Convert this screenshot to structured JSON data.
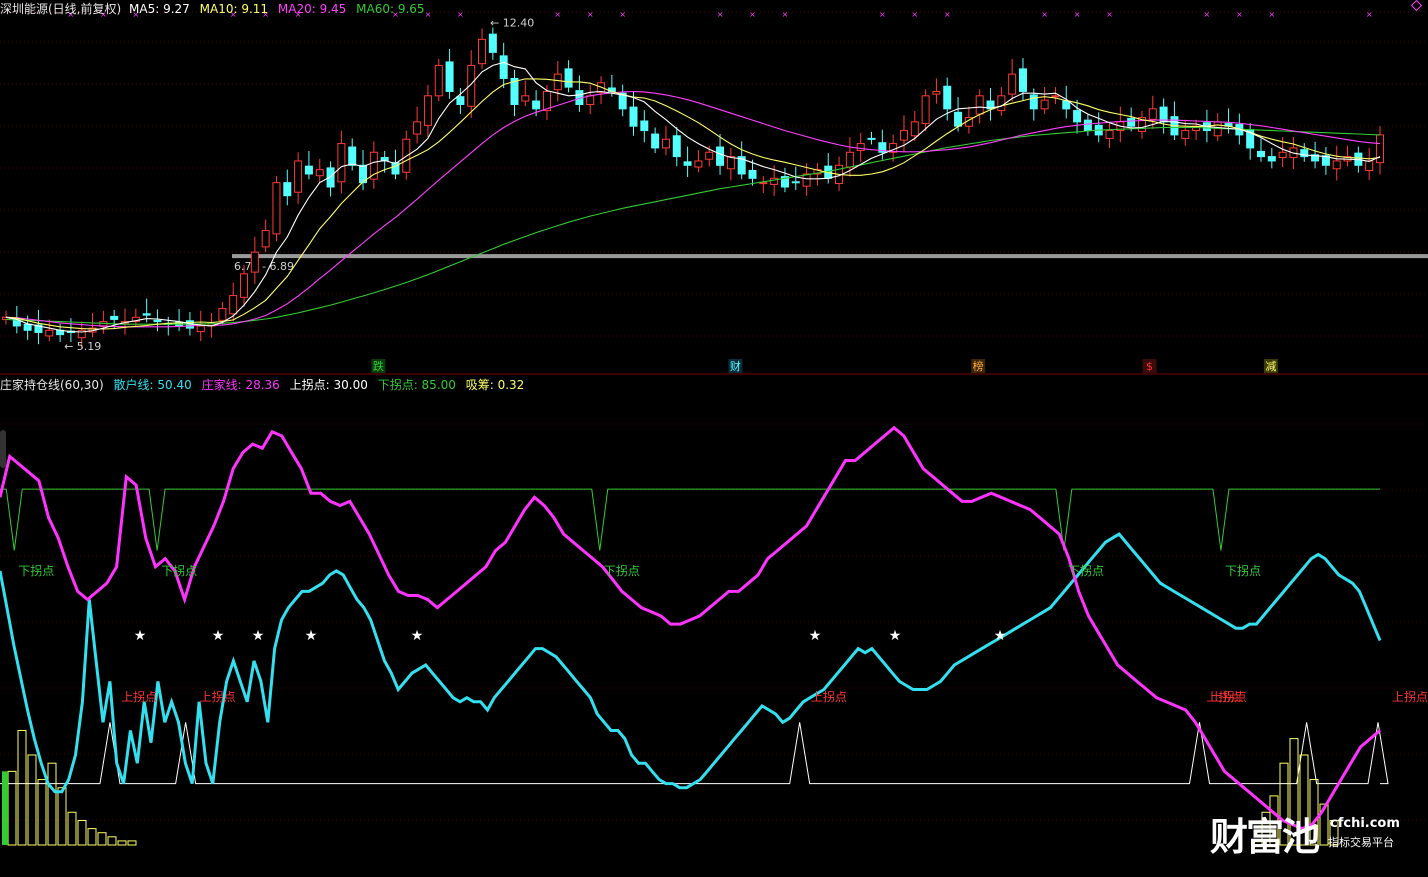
{
  "header_top": {
    "stock": "深圳能源(日线,前复权)",
    "ma5": "MA5: 9.27",
    "ma10": "MA10: 9.11",
    "ma20": "MA20: 9.45",
    "ma60": "MA60: 9.65"
  },
  "header_bottom": {
    "name": "庄家持仓线(60,30)",
    "retail": "散户线: 50.40",
    "dealer": "庄家线: 28.36",
    "up_turn": "上拐点: 30.00",
    "down_turn": "下拐点: 85.00",
    "absorb": "吸筹: 0.32"
  },
  "colors": {
    "up": "#ff3b30",
    "down": "#54ffff",
    "ma5": "#ffffff",
    "ma10": "#ffff66",
    "ma20": "#ff40ff",
    "ma60": "#33cc33",
    "retail_line": "#33e0f0",
    "dealer_line": "#ff33ff",
    "down_turn_line": "#33cc33",
    "up_turn_line": "#ffffff",
    "mark": "#ff40ff"
  },
  "chart_data": {
    "type": "candlestick",
    "panes": [
      "price",
      "indicator"
    ],
    "price": {
      "high_label": "12.40",
      "low_label": "5.19",
      "range_label": "6.78 - 6.89",
      "price_range": [
        5.0,
        12.6
      ],
      "close": [
        5.8,
        5.6,
        5.5,
        5.45,
        5.5,
        5.4,
        5.45,
        5.5,
        5.55,
        5.7,
        5.75,
        5.7,
        5.8,
        5.85,
        5.7,
        5.65,
        5.6,
        5.55,
        5.6,
        5.65,
        6.0,
        6.3,
        6.8,
        7.3,
        7.8,
        8.9,
        8.6,
        9.4,
        9.1,
        9.2,
        8.8,
        9.8,
        9.3,
        8.9,
        9.6,
        9.4,
        9.1,
        9.9,
        10.3,
        10.9,
        11.6,
        11.0,
        10.7,
        11.6,
        12.2,
        11.9,
        11.3,
        10.7,
        10.9,
        10.6,
        11.0,
        11.4,
        11.1,
        10.7,
        10.9,
        11.2,
        11.0,
        10.6,
        10.2,
        10.1,
        9.7,
        9.9,
        9.5,
        9.3,
        9.4,
        9.6,
        9.3,
        9.5,
        9.1,
        9.0,
        8.9,
        9.0,
        8.8,
        8.9,
        9.1,
        9.2,
        9.0,
        9.3,
        9.6,
        9.8,
        9.9,
        9.6,
        9.8,
        10.1,
        10.3,
        10.9,
        11.0,
        10.6,
        10.2,
        10.4,
        10.9,
        10.6,
        10.9,
        11.4,
        11.0,
        10.6,
        10.8,
        10.9,
        10.6,
        10.3,
        10.1,
        10.0,
        10.1,
        10.3,
        10.2,
        10.4,
        10.6,
        10.3,
        10.0,
        10.1,
        10.2,
        10.1,
        10.3,
        10.2,
        10.0,
        9.7,
        9.5,
        9.4,
        9.6,
        9.7,
        9.5,
        9.4,
        9.3,
        9.4,
        9.5,
        9.3,
        9.4,
        10.0
      ],
      "ma5": [
        5.8,
        5.75,
        5.65,
        5.6,
        5.55,
        5.5,
        5.47,
        5.46,
        5.49,
        5.55,
        5.62,
        5.68,
        5.72,
        5.77,
        5.76,
        5.73,
        5.7,
        5.65,
        5.62,
        5.6,
        5.68,
        5.83,
        6.08,
        6.39,
        6.78,
        7.3,
        7.65,
        8.15,
        8.56,
        8.9,
        9.04,
        9.27,
        9.33,
        9.27,
        9.37,
        9.41,
        9.34,
        9.51,
        9.67,
        9.92,
        10.38,
        10.73,
        10.94,
        11.17,
        11.45,
        11.6,
        11.67,
        11.57,
        11.52,
        11.2,
        11.02,
        10.96,
        10.9,
        10.92,
        10.98,
        11.0,
        10.96,
        10.92,
        10.86,
        10.76,
        10.54,
        10.35,
        10.14,
        9.95,
        9.8,
        9.67,
        9.56,
        9.48,
        9.45,
        9.36,
        9.27,
        9.2,
        9.12,
        9.03,
        8.99,
        8.99,
        9.0,
        9.06,
        9.18,
        9.32,
        9.46,
        9.56,
        9.66,
        9.76,
        9.92,
        10.14,
        10.36,
        10.5,
        10.6,
        10.62,
        10.64,
        10.62,
        10.66,
        10.84,
        10.96,
        10.96,
        10.94,
        10.96,
        10.82,
        10.62,
        10.48,
        10.38,
        10.28,
        10.2,
        10.16,
        10.17,
        10.24,
        10.31,
        10.3,
        10.26,
        10.25,
        10.19,
        10.17,
        10.15,
        10.13,
        10.05,
        9.94,
        9.8,
        9.67,
        9.58,
        9.54,
        9.52,
        9.5,
        9.45,
        9.44,
        9.43,
        9.39,
        9.5
      ],
      "ma10": [
        5.8,
        5.78,
        5.72,
        5.66,
        5.62,
        5.58,
        5.56,
        5.54,
        5.53,
        5.53,
        5.54,
        5.57,
        5.59,
        5.61,
        5.64,
        5.66,
        5.67,
        5.68,
        5.69,
        5.68,
        5.7,
        5.74,
        5.87,
        6.02,
        6.19,
        6.47,
        6.74,
        7.11,
        7.47,
        7.84,
        8.12,
        8.42,
        8.67,
        8.92,
        9.09,
        9.2,
        9.28,
        9.41,
        9.53,
        9.66,
        9.84,
        10.06,
        10.29,
        10.53,
        10.77,
        10.99,
        11.16,
        11.23,
        11.29,
        11.29,
        11.28,
        11.25,
        11.22,
        11.22,
        11.19,
        11.1,
        11.0,
        10.93,
        10.87,
        10.85,
        10.78,
        10.67,
        10.55,
        10.42,
        10.28,
        10.12,
        9.95,
        9.79,
        9.66,
        9.56,
        9.48,
        9.42,
        9.37,
        9.31,
        9.25,
        9.19,
        9.13,
        9.09,
        9.07,
        9.07,
        9.1,
        9.15,
        9.24,
        9.36,
        9.52,
        9.68,
        9.86,
        10.03,
        10.19,
        10.34,
        10.47,
        10.58,
        10.67,
        10.73,
        10.79,
        10.85,
        10.88,
        10.85,
        10.79,
        10.74,
        10.67,
        10.58,
        10.52,
        10.47,
        10.42,
        10.35,
        10.31,
        10.25,
        10.21,
        10.2,
        10.19,
        10.2,
        10.23,
        10.2,
        10.14,
        10.06,
        9.97,
        9.9,
        9.84,
        9.79,
        9.71,
        9.63,
        9.56,
        9.51,
        9.48,
        9.47,
        9.45,
        9.48
      ],
      "ma20": [
        5.8,
        5.79,
        5.76,
        5.73,
        5.7,
        5.67,
        5.65,
        5.63,
        5.61,
        5.6,
        5.59,
        5.58,
        5.58,
        5.58,
        5.58,
        5.58,
        5.59,
        5.6,
        5.61,
        5.61,
        5.62,
        5.65,
        5.7,
        5.76,
        5.84,
        5.97,
        6.11,
        6.29,
        6.48,
        6.69,
        6.89,
        7.1,
        7.31,
        7.51,
        7.72,
        7.91,
        8.1,
        8.31,
        8.52,
        8.74,
        8.96,
        9.17,
        9.38,
        9.59,
        9.8,
        10.0,
        10.17,
        10.31,
        10.43,
        10.52,
        10.6,
        10.68,
        10.76,
        10.84,
        10.9,
        10.94,
        10.97,
        10.99,
        11.0,
        10.99,
        10.96,
        10.92,
        10.87,
        10.81,
        10.74,
        10.66,
        10.58,
        10.5,
        10.42,
        10.34,
        10.26,
        10.18,
        10.1,
        10.03,
        9.96,
        9.89,
        9.83,
        9.77,
        9.72,
        9.69,
        9.66,
        9.64,
        9.62,
        9.61,
        9.61,
        9.62,
        9.64,
        9.66,
        9.69,
        9.72,
        9.77,
        9.82,
        9.88,
        9.94,
        10.0,
        10.05,
        10.1,
        10.15,
        10.19,
        10.22,
        10.25,
        10.27,
        10.29,
        10.31,
        10.32,
        10.33,
        10.34,
        10.34,
        10.34,
        10.33,
        10.32,
        10.31,
        10.3,
        10.29,
        10.27,
        10.24,
        10.21,
        10.17,
        10.13,
        10.09,
        10.05,
        10.01,
        9.97,
        9.93,
        9.89,
        9.85,
        9.82,
        9.8
      ],
      "ma60": [
        5.75,
        5.74,
        5.73,
        5.72,
        5.71,
        5.7,
        5.69,
        5.68,
        5.67,
        5.66,
        5.65,
        5.64,
        5.64,
        5.64,
        5.64,
        5.64,
        5.64,
        5.64,
        5.65,
        5.65,
        5.66,
        5.68,
        5.7,
        5.73,
        5.76,
        5.8,
        5.85,
        5.9,
        5.96,
        6.02,
        6.08,
        6.15,
        6.22,
        6.29,
        6.36,
        6.44,
        6.52,
        6.6,
        6.69,
        6.78,
        6.88,
        6.98,
        7.08,
        7.18,
        7.28,
        7.38,
        7.48,
        7.57,
        7.66,
        7.75,
        7.83,
        7.91,
        7.99,
        8.06,
        8.13,
        8.19,
        8.25,
        8.31,
        8.36,
        8.41,
        8.46,
        8.51,
        8.56,
        8.61,
        8.66,
        8.71,
        8.76,
        8.8,
        8.84,
        8.88,
        8.92,
        8.96,
        9.0,
        9.04,
        9.08,
        9.12,
        9.16,
        9.21,
        9.26,
        9.31,
        9.36,
        9.41,
        9.46,
        9.51,
        9.56,
        9.61,
        9.66,
        9.71,
        9.75,
        9.79,
        9.83,
        9.87,
        9.9,
        9.93,
        9.96,
        9.99,
        10.01,
        10.03,
        10.05,
        10.07,
        10.09,
        10.11,
        10.12,
        10.13,
        10.14,
        10.15,
        10.16,
        10.17,
        10.17,
        10.17,
        10.17,
        10.16,
        10.15,
        10.14,
        10.13,
        10.12,
        10.11,
        10.1,
        10.09,
        10.08,
        10.07,
        10.06,
        10.05,
        10.04,
        10.03,
        10.02,
        10.01,
        10.0
      ],
      "signals": [
        {
          "text": "跌",
          "color": "#33cc33",
          "bg": "#0b3a0b",
          "pos": 0.265
        },
        {
          "text": "财",
          "color": "#54ffff",
          "bg": "#0b2a3a",
          "pos": 0.515
        },
        {
          "text": "榜",
          "color": "#ffaa33",
          "bg": "#3a260b",
          "pos": 0.685
        },
        {
          "text": "$",
          "color": "#ff3333",
          "bg": "#3a0b0b",
          "pos": 0.805
        },
        {
          "text": "减",
          "color": "#ffff66",
          "bg": "#3a3a0b",
          "pos": 0.89
        }
      ]
    },
    "indicator": {
      "range": [
        0,
        110
      ],
      "up_turn_label": "上拐点",
      "down_turn_label": "下拐点",
      "star": "★",
      "retail": [
        85,
        95,
        93,
        91,
        89,
        80,
        75,
        68,
        62,
        60,
        62,
        64,
        68,
        90,
        88,
        75,
        68,
        70,
        67,
        60,
        68,
        73,
        78,
        84,
        92,
        96,
        98,
        97,
        101,
        100,
        96,
        92,
        86,
        86,
        84,
        83,
        84,
        80,
        76,
        71,
        66,
        62,
        61,
        61,
        60,
        58,
        60,
        62,
        64,
        66,
        68,
        72,
        74,
        78,
        82,
        85,
        83,
        80,
        76,
        74,
        72,
        70,
        68,
        65,
        62,
        60,
        58,
        57,
        56,
        54,
        54,
        55,
        56,
        58,
        60,
        62,
        62,
        64,
        66,
        70,
        72,
        74,
        76,
        78,
        82,
        86,
        90,
        94,
        94,
        96,
        98,
        100,
        102,
        100,
        96,
        92,
        90,
        88,
        86,
        84,
        84,
        85,
        86,
        85,
        84,
        83,
        82,
        80,
        78,
        76,
        70,
        62,
        56,
        52,
        48,
        44,
        42,
        40,
        38,
        36,
        35,
        34,
        33,
        30,
        26,
        22,
        18,
        16,
        14,
        12,
        10,
        8,
        6,
        5,
        4,
        5,
        8,
        12,
        16,
        20,
        24,
        26,
        28
      ],
      "dealer": [
        67,
        58,
        49,
        41,
        33,
        26,
        20,
        15,
        13,
        13,
        16,
        22,
        35,
        60,
        45,
        30,
        40,
        20,
        15,
        28,
        20,
        35,
        25,
        40,
        30,
        35,
        30,
        20,
        15,
        35,
        20,
        15,
        30,
        40,
        45,
        40,
        35,
        45,
        40,
        30,
        48,
        55,
        58,
        60,
        62,
        62,
        63,
        64,
        66,
        67,
        66,
        63,
        60,
        58,
        55,
        50,
        45,
        42,
        38,
        40,
        42,
        43,
        44,
        42,
        40,
        38,
        36,
        35,
        36,
        35,
        35,
        33,
        36,
        38,
        40,
        42,
        44,
        46,
        48,
        48,
        47,
        46,
        44,
        42,
        40,
        38,
        36,
        32,
        30,
        28,
        28,
        26,
        22,
        20,
        20,
        18,
        16,
        15,
        15,
        14,
        14,
        15,
        16,
        18,
        20,
        22,
        24,
        26,
        28,
        30,
        32,
        34,
        33,
        32,
        30,
        31,
        33,
        35,
        36,
        37,
        38,
        40,
        42,
        44,
        46,
        48,
        47,
        48,
        46,
        44,
        42,
        40,
        39,
        38,
        38,
        38,
        39,
        40,
        42,
        44,
        45,
        46,
        47,
        48,
        49,
        50,
        51,
        52,
        53,
        54,
        55,
        56,
        57,
        58,
        60,
        62,
        64,
        66,
        68,
        70,
        72,
        74,
        75,
        76,
        74,
        72,
        70,
        68,
        66,
        64,
        63,
        62,
        61,
        60,
        59,
        58,
        57,
        56,
        55,
        54,
        53,
        53,
        54,
        54,
        56,
        58,
        60,
        62,
        64,
        66,
        68,
        70,
        71,
        70,
        68,
        66,
        65,
        64,
        62,
        58,
        54,
        50
      ]
    }
  },
  "watermark": {
    "brand": "财富池",
    "site": "cfchi.com",
    "slogan": "指标交易平台"
  }
}
